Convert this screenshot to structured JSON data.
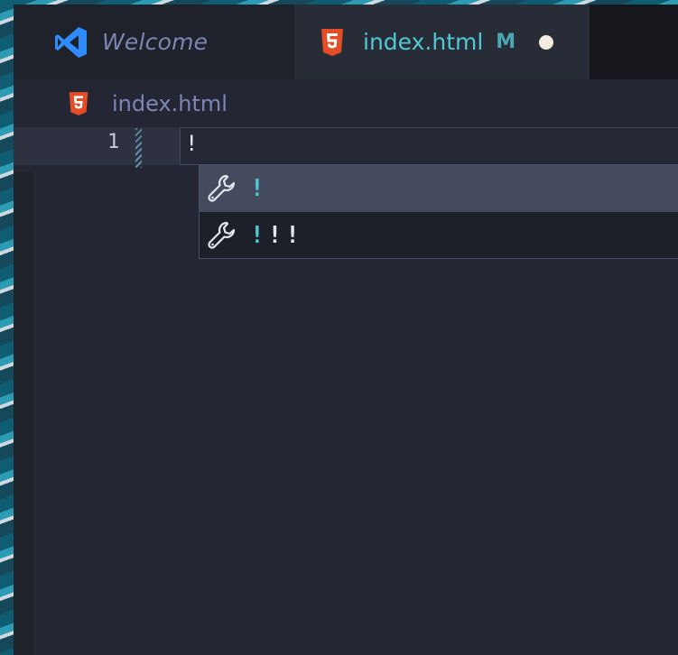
{
  "tabs": [
    {
      "label": "Welcome",
      "icon": "vscode-icon"
    },
    {
      "label": "index.html",
      "icon": "html5-icon",
      "status": "M",
      "unsaved": true
    }
  ],
  "breadcrumb": {
    "icon": "html5-icon",
    "label": "index.html"
  },
  "editor": {
    "lines": [
      {
        "number": "1",
        "text": "!"
      }
    ]
  },
  "suggestions": [
    {
      "match": "!",
      "rest": "",
      "icon": "wrench-icon",
      "selected": true
    },
    {
      "match": "!",
      "rest": "!!",
      "icon": "wrench-icon",
      "selected": false
    }
  ],
  "colors": {
    "accent": "#4ec9d6",
    "html5": "#e44d26",
    "vscode_blue": "#2f8cff"
  }
}
